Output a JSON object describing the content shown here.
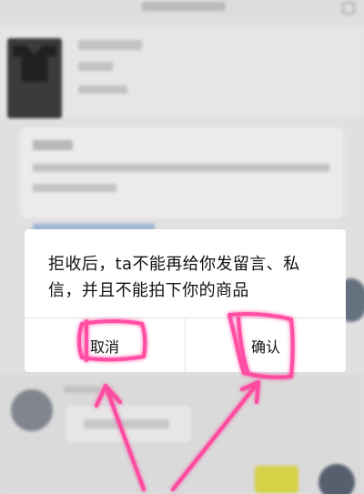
{
  "dialog": {
    "message": "拒收后，ta不能再给你发留言、私信，并且不能拍下你的商品",
    "cancel_label": "取消",
    "confirm_label": "确认"
  },
  "colors": {
    "annotation": "#ff3f9c",
    "background": "#f3f3f3"
  },
  "icons": [
    "menu-icon",
    "avatar",
    "arrow-annotation",
    "highlight-annotation"
  ]
}
